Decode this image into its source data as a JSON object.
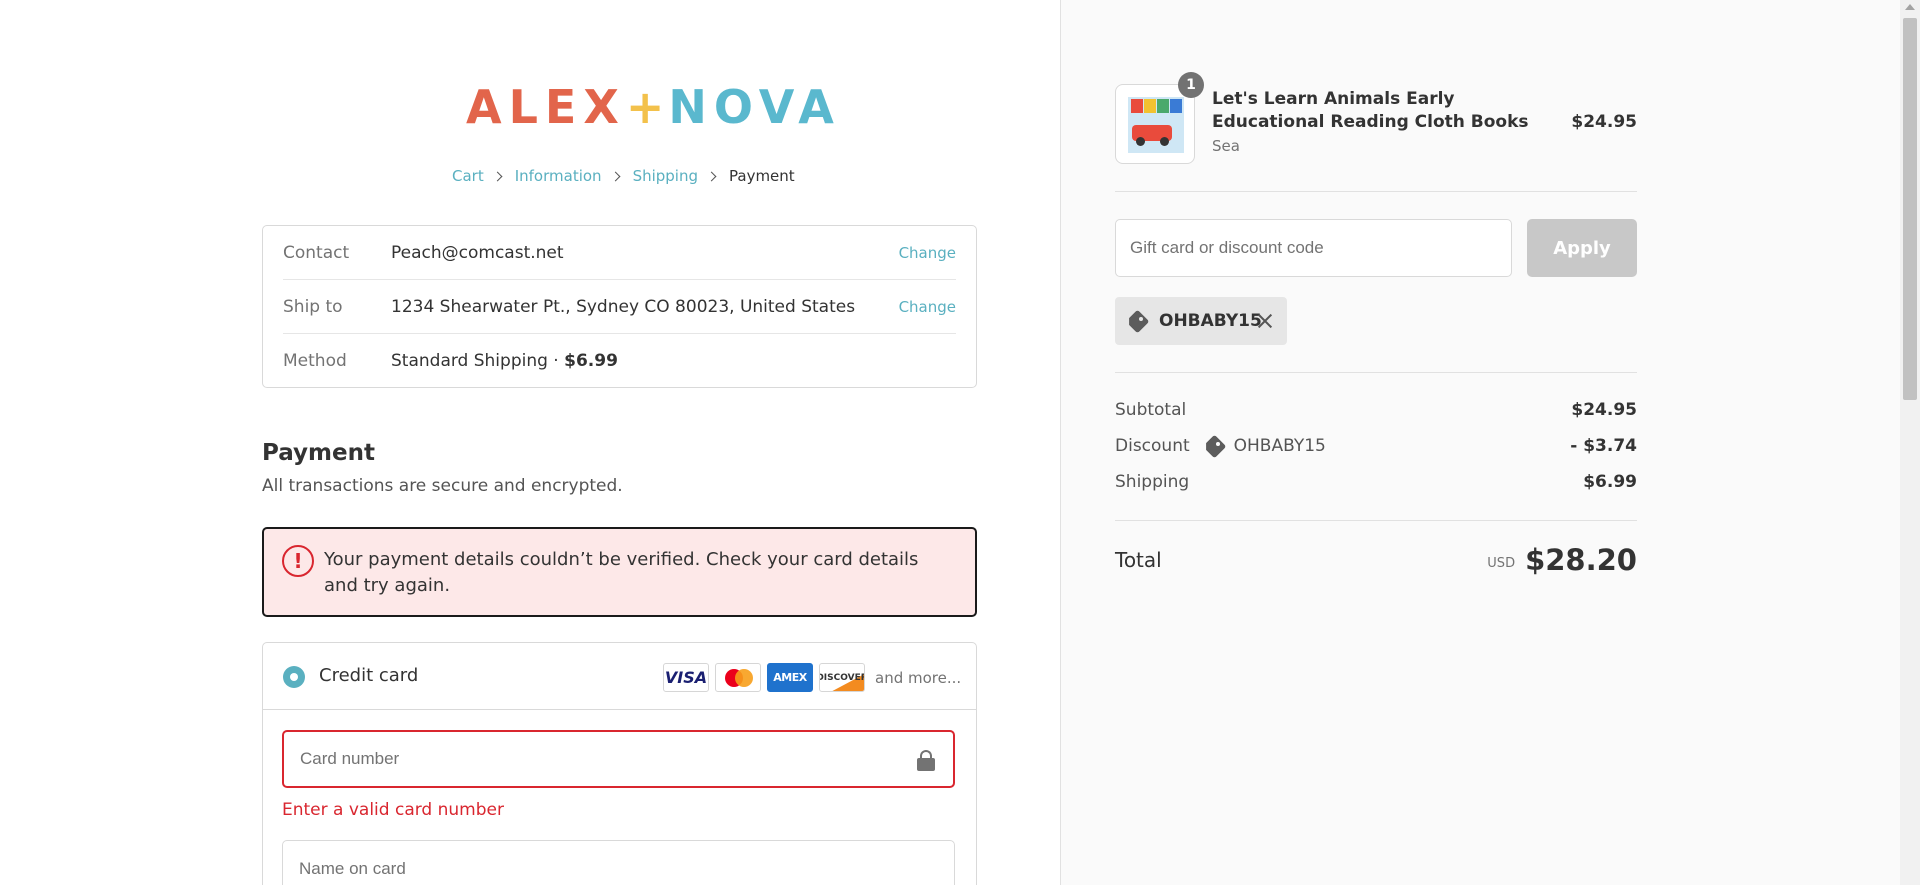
{
  "brand": {
    "name_left": "ALEX",
    "name_plus": "+",
    "name_right": "NOVA"
  },
  "breadcrumb": [
    "Cart",
    "Information",
    "Shipping",
    "Payment"
  ],
  "review": {
    "contact_label": "Contact",
    "contact_value": "Peach@comcast.net",
    "shipto_label": "Ship to",
    "shipto_value": "1234 Shearwater Pt., Sydney CO 80023, United States",
    "method_label": "Method",
    "method_value": "Standard Shipping · ",
    "method_price": "$6.99",
    "change_label": "Change"
  },
  "payment": {
    "title": "Payment",
    "subtitle": "All transactions are secure and encrypted.",
    "error": "Your payment details couldn’t be verified. Check your card details and try again.",
    "error_symbol": "!",
    "method_label": "Credit card",
    "card_brands": [
      "VISA",
      "Mastercard",
      "AMEX",
      "DISCOVER"
    ],
    "and_more": "and more...",
    "card_number_placeholder": "Card number",
    "card_number_error": "Enter a valid card number",
    "name_on_card_placeholder": "Name on card"
  },
  "order": {
    "product_title": "Let's Learn Animals Early Educational Reading Cloth Books",
    "product_variant": "Sea",
    "product_price": "$24.95",
    "quantity": "1",
    "discount_placeholder": "Gift card or discount code",
    "apply_label": "Apply",
    "applied_code": "OHBABY15",
    "subtotal_label": "Subtotal",
    "subtotal_value": "$24.95",
    "discount_label": "Discount",
    "discount_value": "- $3.74",
    "shipping_label": "Shipping",
    "shipping_value": "$6.99",
    "total_label": "Total",
    "total_currency": "USD",
    "total_value": "$28.20"
  },
  "colors": {
    "accent": "#5ab0c0",
    "error": "#d9262f",
    "error_bg": "#fde8e8"
  }
}
